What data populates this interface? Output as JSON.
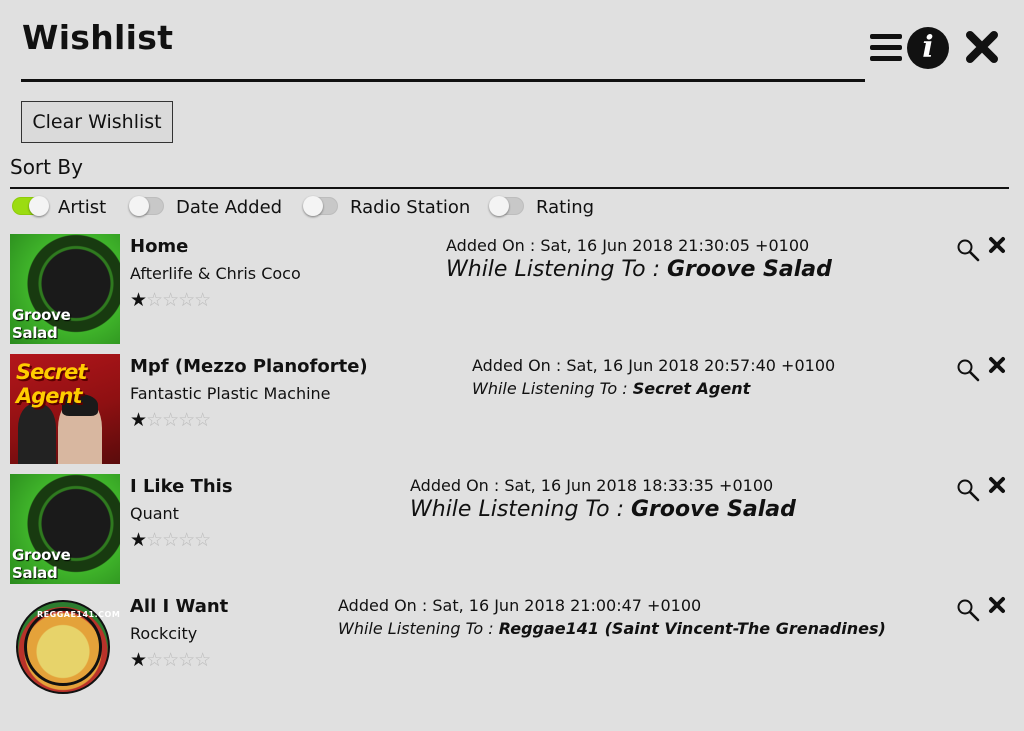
{
  "header": {
    "title": "Wishlist"
  },
  "icons": {
    "menu": "menu-icon",
    "info": "info-icon",
    "info_glyph": "i",
    "close": "close-icon",
    "search": "search-icon",
    "delete": "delete-icon"
  },
  "actions": {
    "clear_label": "Clear Wishlist"
  },
  "sort": {
    "label": "Sort By",
    "options": [
      {
        "label": "Artist",
        "on": true
      },
      {
        "label": "Date Added",
        "on": false
      },
      {
        "label": "Radio Station",
        "on": false
      },
      {
        "label": "Rating",
        "on": false
      }
    ]
  },
  "colors": {
    "background": "#e0e0e0",
    "toggle_on": "#9bdc11",
    "text": "#111111"
  },
  "items": [
    {
      "track": "Home",
      "artist": "Afterlife & Chris Coco",
      "rating": 1,
      "rating_max": 5,
      "added_prefix": "Added On : ",
      "added": "Sat, 16 Jun 2018 21:30:05 +0100",
      "listening_prefix": "While Listening To : ",
      "station": "Groove Salad",
      "art_label": "Groove Salad"
    },
    {
      "track": "Mpf (Mezzo Planoforte)",
      "artist": "Fantastic Plastic Machine",
      "rating": 1,
      "rating_max": 5,
      "added_prefix": "Added On : ",
      "added": "Sat, 16 Jun 2018 20:57:40 +0100",
      "listening_prefix": "While Listening To : ",
      "station": "Secret Agent",
      "art_label": "Secret Agent"
    },
    {
      "track": "I Like This",
      "artist": "Quant",
      "rating": 1,
      "rating_max": 5,
      "added_prefix": "Added On : ",
      "added": "Sat, 16 Jun 2018 18:33:35 +0100",
      "listening_prefix": "While Listening To : ",
      "station": "Groove Salad",
      "art_label": "Groove Salad"
    },
    {
      "track": "All I Want",
      "artist": "Rockcity",
      "rating": 1,
      "rating_max": 5,
      "added_prefix": "Added On : ",
      "added": "Sat, 16 Jun 2018 21:00:47 +0100",
      "listening_prefix": "While Listening To : ",
      "station": "Reggae141 (Saint Vincent-The Grenadines)",
      "art_label": "REGGAE141.COM"
    }
  ]
}
